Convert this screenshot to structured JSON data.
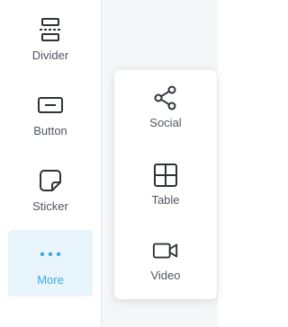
{
  "sidebar": {
    "items": [
      {
        "label": "Divider",
        "icon": "divider-icon"
      },
      {
        "label": "Button",
        "icon": "button-icon"
      },
      {
        "label": "Sticker",
        "icon": "sticker-icon"
      },
      {
        "label": "More",
        "icon": "more-dots-icon",
        "active": true
      }
    ]
  },
  "more_menu": {
    "items": [
      {
        "label": "Social",
        "icon": "share-icon"
      },
      {
        "label": "Table",
        "icon": "table-icon"
      },
      {
        "label": "Video",
        "icon": "video-icon"
      }
    ]
  },
  "colors": {
    "icon": "#2f3238",
    "text": "#51565e",
    "accent": "#3fa7e0",
    "active_bg": "#e8f5fc",
    "canvas_bg": "#f5f6f8"
  }
}
